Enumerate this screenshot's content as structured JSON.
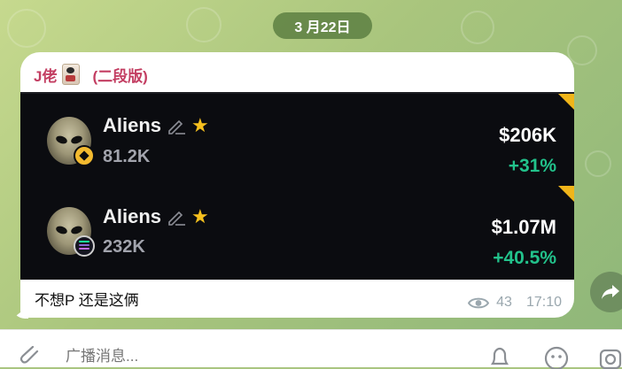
{
  "date": "3 月22日",
  "message": {
    "sender": "J佬",
    "sender_suffix": "(二段版)",
    "caption": "不想P 还是这俩",
    "views": "43",
    "time": "17:10",
    "card": {
      "rows": [
        {
          "name": "Aliens",
          "mcap": "81.2K",
          "price": "$206K",
          "change": "+31%",
          "chain": "bnb-icon"
        },
        {
          "name": "Aliens",
          "mcap": "232K",
          "price": "$1.07M",
          "change": "+40.5%",
          "chain": "solana-icon"
        }
      ]
    }
  },
  "input": {
    "placeholder": "广播消息..."
  },
  "colors": {
    "sender": "#c33e62",
    "positive": "#22c28b",
    "star": "#f6c01e",
    "corner": "#f0b51a"
  }
}
